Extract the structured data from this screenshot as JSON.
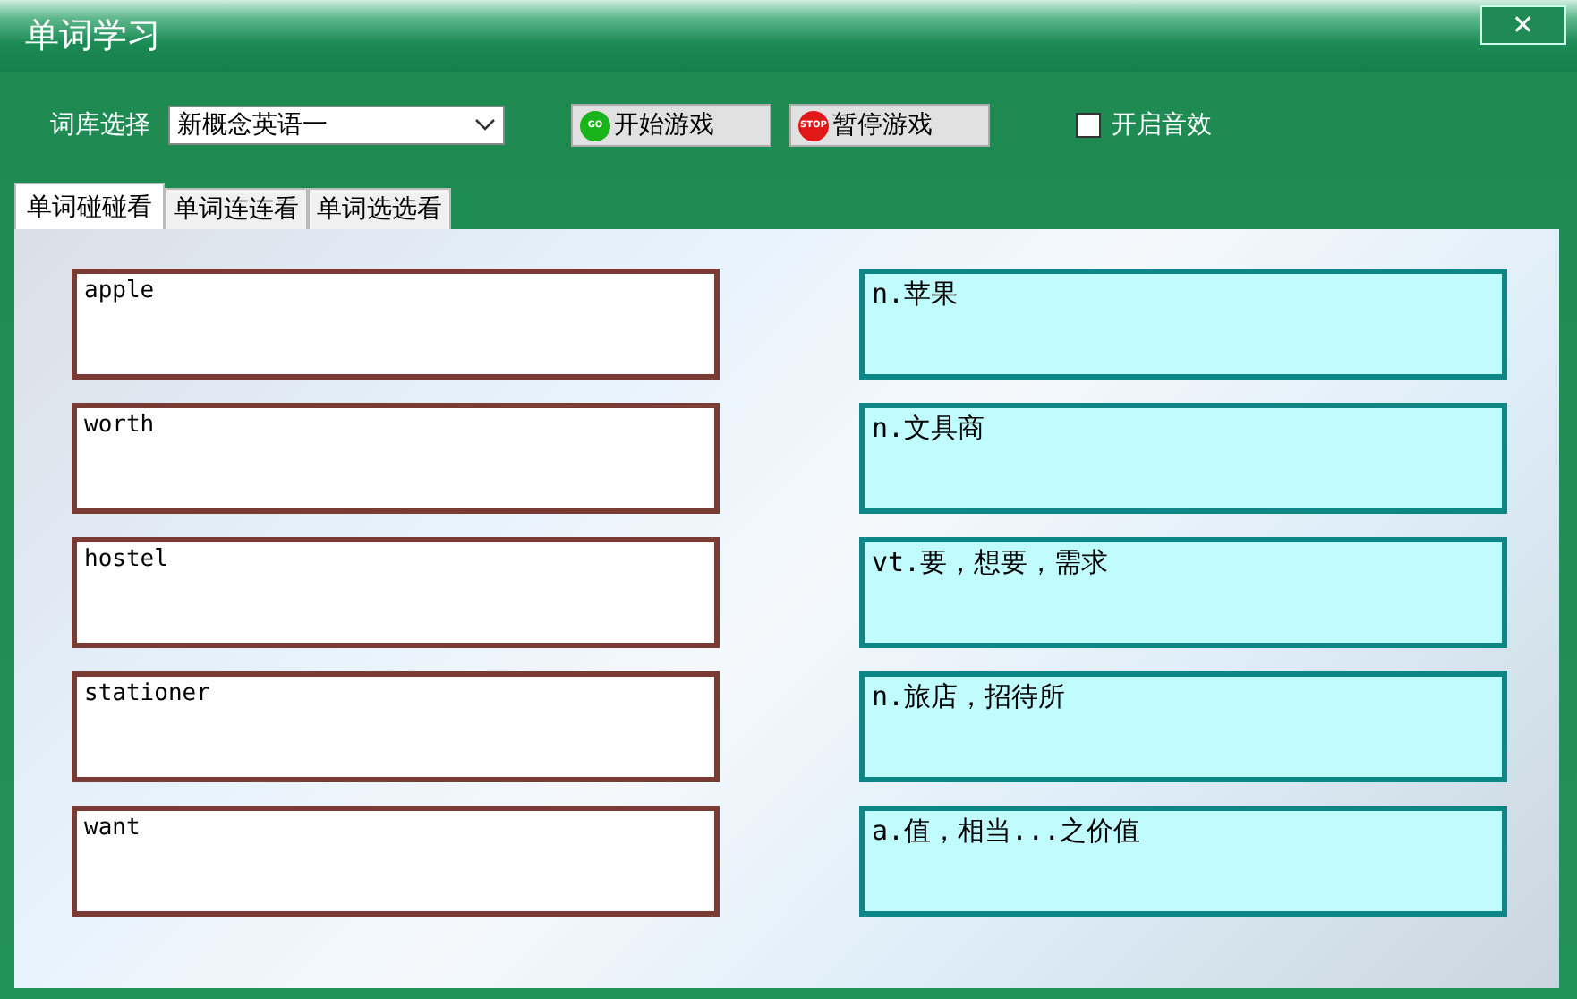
{
  "window": {
    "title": "单词学习",
    "close": "✕"
  },
  "toolbar": {
    "library_label": "词库选择",
    "library": {
      "value": "新概念英语一"
    },
    "buttons": [
      {
        "kind": "go",
        "badge": "GO",
        "label": "开始游戏"
      },
      {
        "kind": "stop",
        "badge": "STOP",
        "label": "暂停游戏"
      }
    ],
    "sound": {
      "label": "开启音效",
      "checked": false
    }
  },
  "tabs": [
    {
      "label": "单词碰碰看",
      "selected": true
    },
    {
      "label": "单词连连看",
      "selected": false
    },
    {
      "label": "单词选选看",
      "selected": false
    }
  ],
  "words": [
    "apple",
    "worth",
    "hostel",
    "stationer",
    "want"
  ],
  "meanings": [
    "n.苹果",
    "n.文具商",
    "vt.要，想要，需求",
    "n.旅店，招待所",
    "a.值，相当...之价值"
  ]
}
